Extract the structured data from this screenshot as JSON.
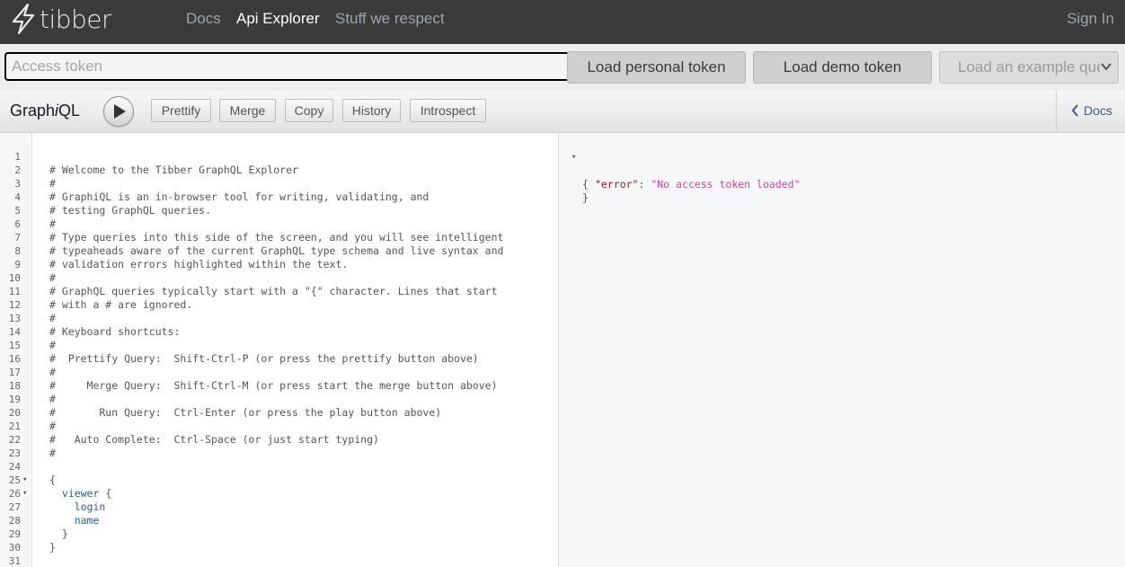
{
  "nav": {
    "brand": "tibber",
    "links": [
      "Docs",
      "Api Explorer",
      "Stuff we respect"
    ],
    "active_link": "Api Explorer",
    "signin": "Sign In"
  },
  "tokenbar": {
    "token_placeholder": "Access token",
    "load_personal": "Load personal token",
    "load_demo": "Load demo token",
    "example_select": "Load an example query"
  },
  "graphiql": {
    "title_prefix": "Graph",
    "title_italic": "i",
    "title_suffix": "QL",
    "buttons": [
      "Prettify",
      "Merge",
      "Copy",
      "History",
      "Introspect"
    ],
    "docs_label": "Docs"
  },
  "editor": {
    "lines": [
      "",
      "# Welcome to the Tibber GraphQL Explorer",
      "#",
      "# GraphiQL is an in-browser tool for writing, validating, and",
      "# testing GraphQL queries.",
      "#",
      "# Type queries into this side of the screen, and you will see intelligent",
      "# typeaheads aware of the current GraphQL type schema and live syntax and",
      "# validation errors highlighted within the text.",
      "#",
      "# GraphQL queries typically start with a \"{\" character. Lines that start",
      "# with a # are ignored.",
      "#",
      "# Keyboard shortcuts:",
      "#",
      "#  Prettify Query:  Shift-Ctrl-P (or press the prettify button above)",
      "#",
      "#     Merge Query:  Shift-Ctrl-M (or press start the merge button above)",
      "#",
      "#       Run Query:  Ctrl-Enter (or press the play button above)",
      "#",
      "#   Auto Complete:  Ctrl-Space (or just start typing)",
      "#",
      "",
      "{",
      "  viewer {",
      "    login",
      "    name",
      "  }",
      "}",
      ""
    ],
    "fold_lines": [
      25,
      26
    ]
  },
  "result": {
    "open": "{",
    "key": "\"error\"",
    "sep": ": ",
    "value": "\"No access token loaded\"",
    "close": "}"
  },
  "colors": {
    "nav_bg": "#3b3b3b",
    "nav_link": "#9aa6ad",
    "comment": "#555555",
    "field": "#1f61a0",
    "json_key": "#aa1111",
    "json_string": "#d64292"
  }
}
